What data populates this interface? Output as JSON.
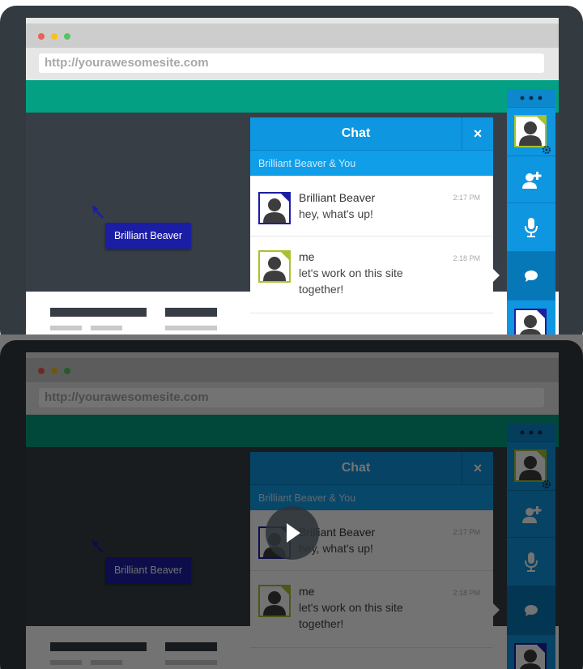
{
  "browser": {
    "url": "http://yourawesomesite.com"
  },
  "cursor_tag": {
    "label": "Brilliant Beaver"
  },
  "chat": {
    "title": "Chat",
    "close_icon": "×",
    "subtitle": "Brilliant Beaver & You",
    "messages": [
      {
        "sender": "Brilliant Beaver",
        "text": "hey, what's up!",
        "time": "2:17 PM",
        "avatar_color": "#1b1ea4"
      },
      {
        "sender": "me",
        "text": "let's work on this site together!",
        "time": "2:18 PM",
        "avatar_color": "#a6c22e"
      }
    ]
  },
  "sidebar": {
    "items": [
      "settings-avatar",
      "add-user-icon",
      "microphone-icon",
      "chat-bubble-icon",
      "user-avatar"
    ]
  },
  "video": {
    "play_icon": "play-icon"
  },
  "colors": {
    "frame": "#333b41",
    "accent_green": "#03a084",
    "chat_blue": "#0e96e1",
    "tag_blue": "#1b1ea4",
    "me_green": "#a6c22e"
  }
}
